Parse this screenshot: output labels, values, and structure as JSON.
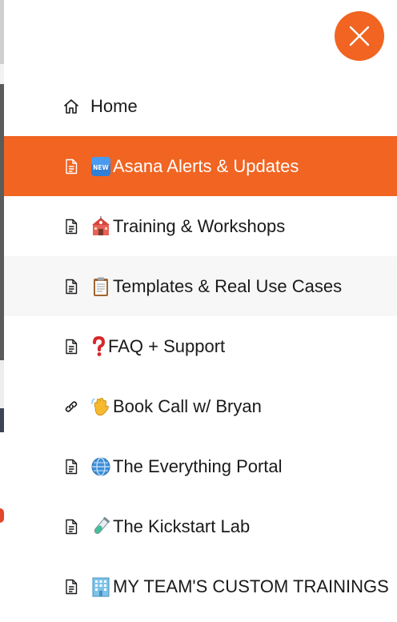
{
  "colors": {
    "accent": "#f16422",
    "hover_bg": "#f7f7f7",
    "text": "#1a1a1a"
  },
  "close_button": {
    "icon": "close-icon"
  },
  "menu": {
    "items": [
      {
        "label": "Home",
        "emoji": "",
        "icon": "home-icon"
      },
      {
        "label": "Asana Alerts & Updates",
        "emoji": "new-badge-emoji",
        "icon": "page-icon",
        "active": true
      },
      {
        "label": "Training & Workshops",
        "emoji": "school-emoji",
        "icon": "page-icon"
      },
      {
        "label": "Templates & Real Use Cases",
        "emoji": "clipboard-emoji",
        "icon": "page-icon",
        "hover": true
      },
      {
        "label": "FAQ + Support",
        "emoji": "question-mark-emoji",
        "icon": "page-icon"
      },
      {
        "label": "Book Call w/ Bryan",
        "emoji": "waving-hand-emoji",
        "icon": "link-icon"
      },
      {
        "label": "The Everything Portal",
        "emoji": "globe-emoji",
        "icon": "page-icon"
      },
      {
        "label": "The Kickstart Lab",
        "emoji": "test-tube-emoji",
        "icon": "page-icon"
      },
      {
        "label": "MY TEAM'S CUSTOM TRAININGS",
        "emoji": "office-building-emoji",
        "icon": "page-icon"
      }
    ]
  }
}
